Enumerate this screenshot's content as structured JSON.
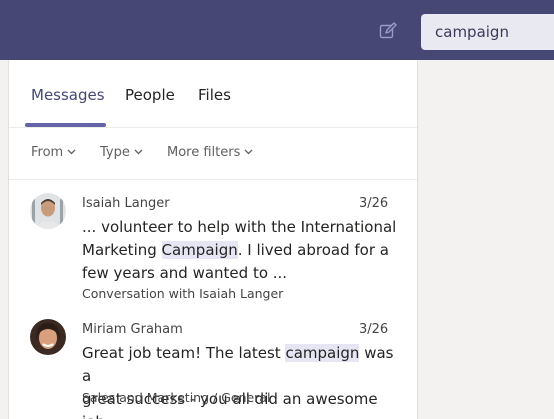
{
  "search": {
    "query": "campaign"
  },
  "tabs": [
    {
      "label": "Messages",
      "active": true
    },
    {
      "label": "People",
      "active": false
    },
    {
      "label": "Files",
      "active": false
    }
  ],
  "filters": [
    {
      "label": "From"
    },
    {
      "label": "Type"
    },
    {
      "label": "More filters"
    }
  ],
  "results": [
    {
      "name": "Isaiah Langer",
      "date": "3/26",
      "line1": "... volunteer to help with the International",
      "line2_pre": "Marketing ",
      "line2_hl": "Campaign",
      "line2_post": ". I lived abroad for a",
      "line3": "few years and wanted to ...",
      "context": "Conversation with Isaiah Langer"
    },
    {
      "name": "Miriam Graham",
      "date": "3/26",
      "line1_pre": "Great job team! The latest ",
      "line1_hl": "campaign",
      "line1_post": " was a",
      "line2": "great success - you all did an awesome job.",
      "context": "Sales and Marketing / General"
    }
  ],
  "colors": {
    "topbar": "#464775",
    "accent": "#6264a7",
    "highlight": "#e5e5f4"
  },
  "icons": [
    "compose-icon",
    "chevron-down-icon"
  ]
}
